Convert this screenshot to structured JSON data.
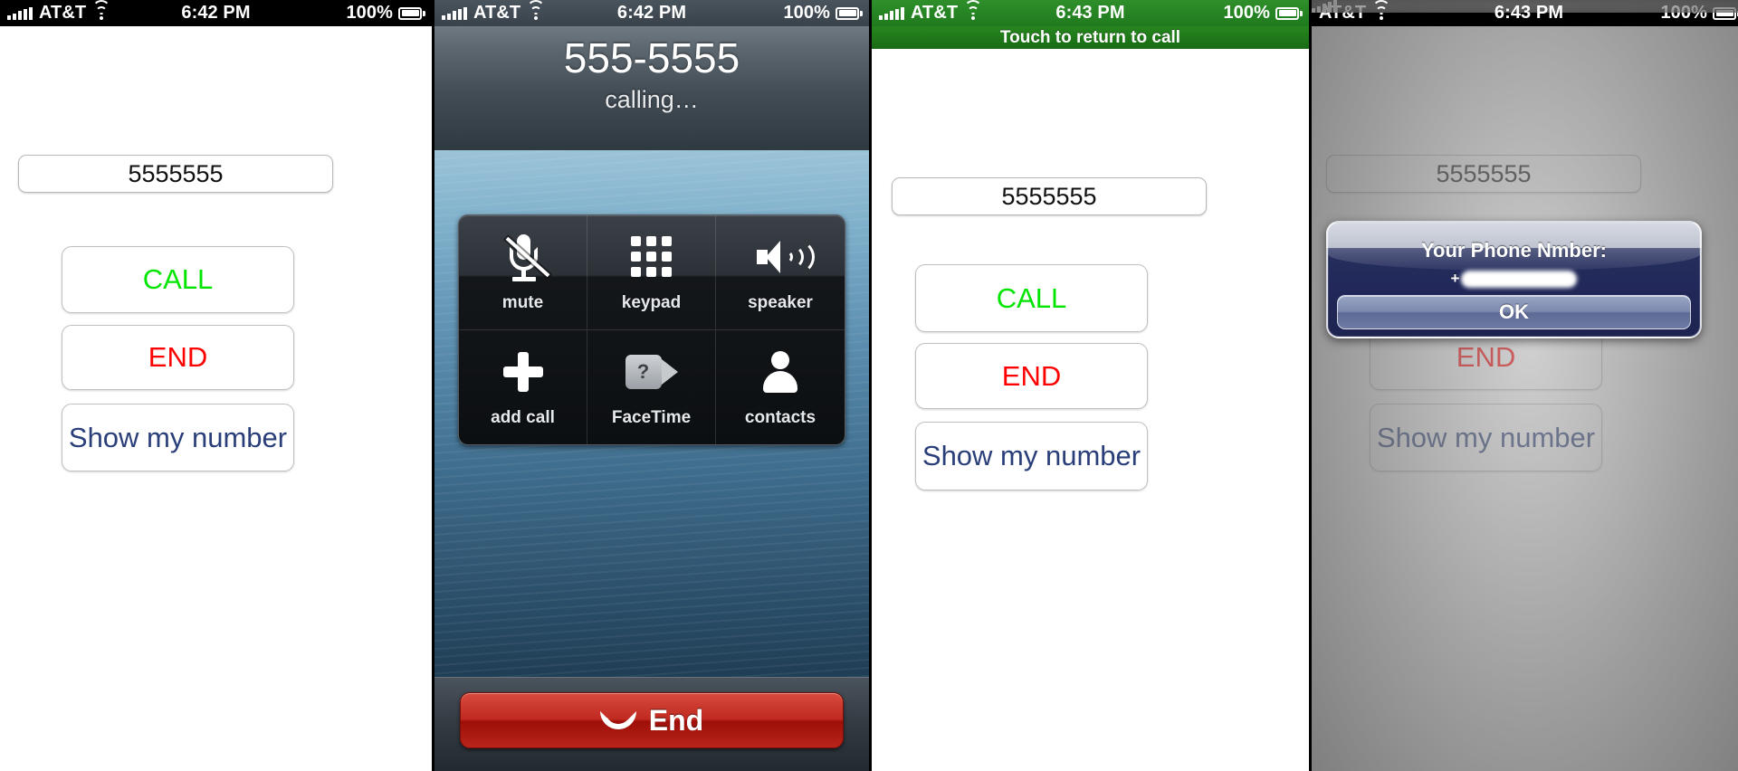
{
  "panels": [
    {
      "id": "dialer-idle",
      "statusbar": {
        "carrier": "AT&T",
        "time": "6:42 PM",
        "battery": "100%"
      },
      "number_field": {
        "value": "5555555"
      },
      "buttons": {
        "call": "CALL",
        "end": "END",
        "show_number": "Show my number"
      }
    },
    {
      "id": "in-call",
      "statusbar": {
        "carrier": "AT&T",
        "time": "6:42 PM",
        "battery": "100%"
      },
      "call": {
        "number": "555-5555",
        "status": "calling…",
        "actions": [
          {
            "label": "mute",
            "icon": "microphone-muted-icon"
          },
          {
            "label": "keypad",
            "icon": "keypad-icon"
          },
          {
            "label": "speaker",
            "icon": "speaker-icon"
          },
          {
            "label": "add call",
            "icon": "plus-icon"
          },
          {
            "label": "FaceTime",
            "icon": "facetime-video-icon"
          },
          {
            "label": "contacts",
            "icon": "contacts-person-icon"
          }
        ],
        "end_label": "End"
      }
    },
    {
      "id": "dialer-during-call",
      "statusbar": {
        "carrier": "AT&T",
        "time": "6:43 PM",
        "battery": "100%",
        "banner": "Touch to return to call"
      },
      "number_field": {
        "value": "5555555"
      },
      "buttons": {
        "call": "CALL",
        "end": "END",
        "show_number": "Show my number"
      }
    },
    {
      "id": "dialer-alert",
      "statusbar": {
        "carrier": "AT&T",
        "time": "6:43 PM",
        "battery": "100%"
      },
      "number_field": {
        "value": "5555555"
      },
      "buttons": {
        "call": "CALL",
        "end": "END",
        "show_number": "Show my number"
      },
      "alert": {
        "title": "Your Phone Nmber:",
        "message_prefix": "+",
        "message_redacted": true,
        "ok_label": "OK"
      }
    }
  ],
  "colors": {
    "call_green": "#00e500",
    "end_red": "#ff0000",
    "show_number_blue": "#2a3f7a",
    "status_green": "#1f7a1d",
    "end_button_red": "#c02a20",
    "alert_navy": "#22295a"
  }
}
